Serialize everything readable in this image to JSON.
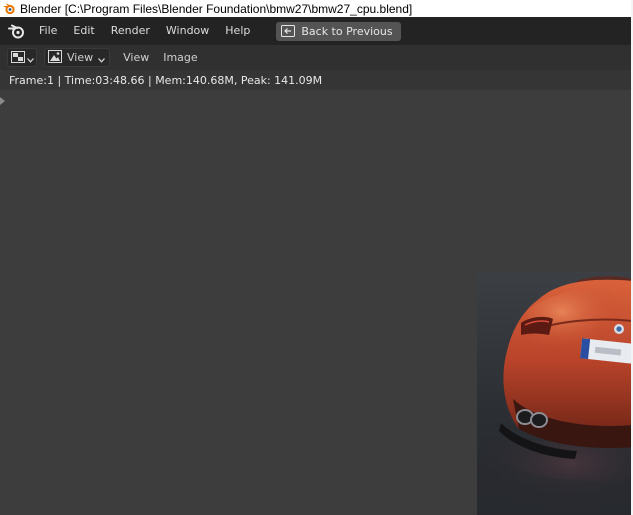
{
  "window": {
    "title": "Blender [C:\\Program Files\\Blender Foundation\\bmw27\\bmw27_cpu.blend]",
    "icon": "blender-icon"
  },
  "menubar": {
    "logo": "blender-logo-icon",
    "items": [
      {
        "label": "File"
      },
      {
        "label": "Edit"
      },
      {
        "label": "Render"
      },
      {
        "label": "Window"
      },
      {
        "label": "Help"
      }
    ],
    "back_button": {
      "label": "Back to Previous",
      "icon": "back-arrow-icon"
    }
  },
  "header": {
    "editor_type_icon": "image-editor-icon",
    "view_dropdown": {
      "label": "View",
      "icon": "image-icon"
    },
    "menus": [
      {
        "label": "View"
      },
      {
        "label": "Image"
      }
    ]
  },
  "render_info": {
    "stats": "Frame:1 | Time:03:48.66 | Mem:140.68M, Peak: 141.09M"
  },
  "colors": {
    "menubar_bg": "#232323",
    "header_bg": "#303030",
    "viewport_bg": "#3d3d3d",
    "button_bg": "#545454",
    "car_paint": "#c0462a"
  }
}
